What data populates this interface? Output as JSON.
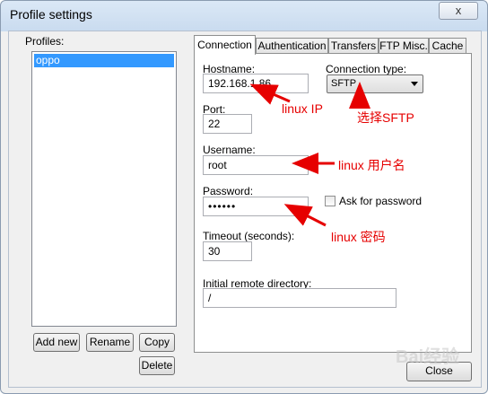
{
  "window": {
    "title": "Profile settings",
    "close_glyph": "x"
  },
  "profiles": {
    "label": "Profiles:",
    "items": [
      "oppo"
    ],
    "buttons": {
      "add_new": "Add new",
      "rename": "Rename",
      "copy": "Copy",
      "delete": "Delete"
    }
  },
  "tabs": [
    "Connection",
    "Authentication",
    "Transfers",
    "FTP Misc.",
    "Cache"
  ],
  "connection": {
    "hostname_label": "Hostname:",
    "hostname_value": "192.168.1.86",
    "connection_type_label": "Connection type:",
    "connection_type_value": "SFTP",
    "port_label": "Port:",
    "port_value": "22",
    "username_label": "Username:",
    "username_value": "root",
    "password_label": "Password:",
    "password_value": "••••••",
    "ask_password_label": "Ask for password",
    "ask_password_checked": false,
    "timeout_label": "Timeout (seconds):",
    "timeout_value": "30",
    "remote_dir_label": "Initial remote directory:",
    "remote_dir_value": "/"
  },
  "annotations": {
    "linux_ip": "linux IP",
    "select_sftp": "选择SFTP",
    "linux_username": "linux 用户名",
    "linux_password": "linux 密码"
  },
  "footer": {
    "close_label": "Close"
  },
  "watermark": "Bai经验",
  "colors": {
    "annotation": "#e60000",
    "selection": "#3399ff"
  }
}
